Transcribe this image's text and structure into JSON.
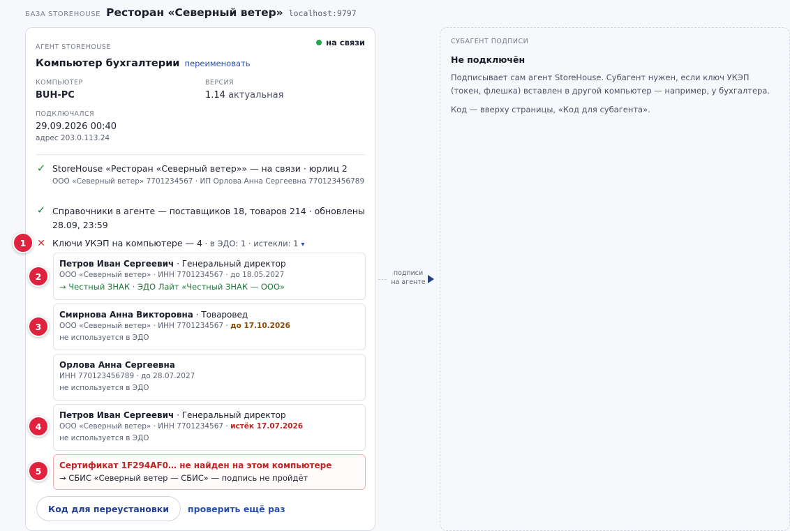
{
  "header": {
    "db_label": "БАЗА STOREHOUSE",
    "db_name": "Ресторан «Северный ветер»",
    "host": "localhost:9797"
  },
  "agent": {
    "section_label": "АГЕНТ STOREHOUSE",
    "status_text": "на связи",
    "status_color": "#1ea84b",
    "computer_name": "Компьютер бухгалтерии",
    "rename_label": "переименовать",
    "computer_label": "КОМПЬЮТЕР",
    "computer_value": "BUH-PC",
    "version_label": "ВЕРСИЯ",
    "version_value": "1.14",
    "version_status": "актуальная",
    "connected_label": "ПОДКЛЮЧАЛСЯ",
    "connected_value": "29.09.2026 00:40",
    "address": "адрес 203.0.113.24"
  },
  "checks": {
    "storehouse": {
      "main": "StoreHouse «Ресторан «Северный ветер»» — на связи · юрлиц 2",
      "sub": "ООО «Северный ветер» 7701234567 · ИП Орлова Анна Сергеевна 770123456789"
    },
    "directories": {
      "main": "Справочники в агенте — поставщиков 18, товаров 214 · обновлены 28.09, 23:59"
    },
    "keys": {
      "main": "Ключи УКЭП на компьютере — 4",
      "meta": " · в ЭДО: 1 · истекли: 1",
      "caret": "▾"
    }
  },
  "keys": [
    {
      "badge": "2",
      "name": "Петров Иван Сергеевич",
      "role": " · Генеральный директор",
      "detail": "ООО «Северный ветер» · ИНН 7701234567 · до 18.05.2027",
      "route": "→ Честный ЗНАК · ЭДО Лайт «Честный ЗНАК — ООО»"
    },
    {
      "badge": "3",
      "name": "Смирнова Анна Викторовна",
      "role": " · Товаровед",
      "detail": "ООО «Северный ветер» · ИНН 7701234567 · ",
      "detail_warn": "до 17.10.2026",
      "usage": "не используется в ЭДО"
    },
    {
      "name": "Орлова Анна Сергеевна",
      "detail": "ИНН 770123456789 · до 28.07.2027",
      "usage": "не используется в ЭДО"
    },
    {
      "badge": "4",
      "name": "Петров Иван Сергеевич",
      "role": " · Генеральный директор",
      "detail": "ООО «Северный ветер» · ИНН 7701234567 · ",
      "detail_expired": "истёк 17.07.2026",
      "usage": "не используется в ЭДО"
    },
    {
      "badge": "5",
      "error_title": "Сертификат 1F294AF0… не найден на этом компьютере",
      "error_route": "→ СБИС «Северный ветер — СБИС» — подпись не пройдёт"
    }
  ],
  "badges": {
    "keys_row": "1"
  },
  "actions": {
    "reinstall_code": "Код для переустановки",
    "recheck": "проверить ещё раз"
  },
  "connector": {
    "label": "подписи на агенте"
  },
  "subagent": {
    "section_label": "СУБАГЕНТ ПОДПИСИ",
    "title": "Не подключён",
    "text": "Подписывает сам агент StoreHouse. Субагент нужен, если ключ УКЭП (токен, флешка) вставлен в другой компьютер — например, у бухгалтера.",
    "hint": "Код — вверху страницы, «Код для субагента»."
  },
  "colors": {
    "accent": "#2a4fb0",
    "badge": "#e0223f",
    "ok": "#1c8a3a",
    "error": "#c02525",
    "warning": "#8a4b00"
  }
}
